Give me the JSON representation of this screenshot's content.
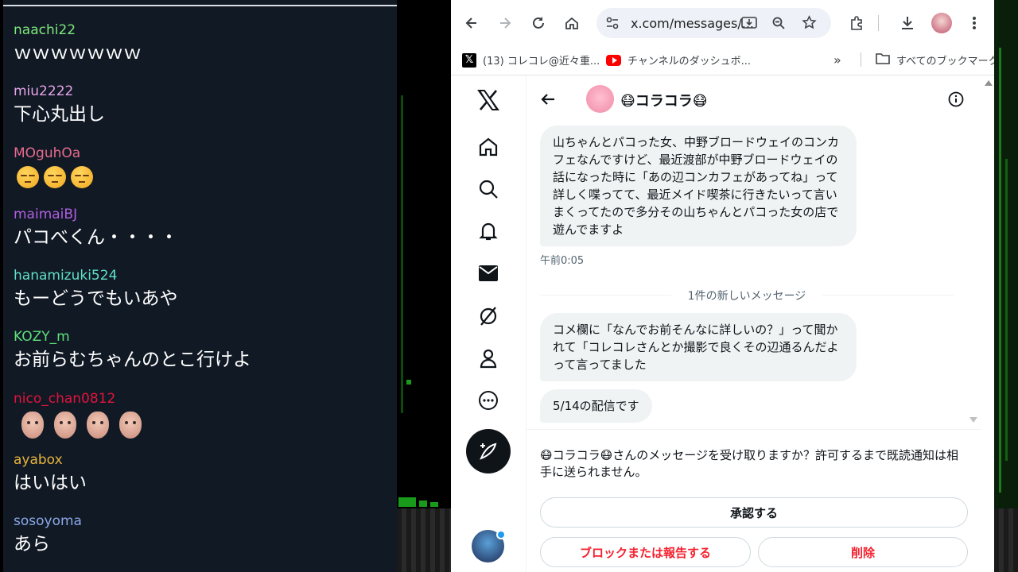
{
  "chat": {
    "messages": [
      {
        "user": "naachi22",
        "color": "#7de87a",
        "text": "ｗｗｗｗｗｗｗ"
      },
      {
        "user": "miu2222",
        "color": "#e5a4e8",
        "text": "下心丸出し"
      },
      {
        "user": "MOguhOa",
        "color": "#e86b8d",
        "emoji": "pensive-face-icon",
        "count": 3
      },
      {
        "user": "maimaiBJ",
        "color": "#b05fe0",
        "text": "パコべくん・・・・"
      },
      {
        "user": "hanamizuki524",
        "color": "#5fe0c8",
        "text": "もーどうでもいあや"
      },
      {
        "user": "KOZY_m",
        "color": "#5fe07a",
        "text": "お前らむちゃんのとこ行けよ"
      },
      {
        "user": "nico_chan0812",
        "color": "#e0143c",
        "emoji": "face-sticker-icon",
        "count": 4
      },
      {
        "user": "ayabox",
        "color": "#e8b43c",
        "text": "はいはい"
      },
      {
        "user": "sosoyoma",
        "color": "#8aa8e8",
        "text": "あら"
      }
    ]
  },
  "browser": {
    "url": "x.com/messages/...",
    "bookmarks": [
      {
        "label": "(13) コレコレ@近々重...",
        "icon": "x-logo-icon"
      },
      {
        "label": "チャンネルのダッシュボ...",
        "icon": "youtube-icon"
      }
    ],
    "all_bookmarks": "すべてのブックマーク"
  },
  "conversation": {
    "name": "😷コラコラ😷",
    "messages": [
      "山ちゃんとパコった女、中野ブロードウェイのコンカフェなんですけど、最近渡部が中野ブロードウェイの話になった時に「あの辺コンカフェがあってね」って詳しく喋ってて、最近メイド喫茶に行きたいって言いまくってたので多分その山ちゃんとパコった女の店で遊んでますよ",
      "コメ欄に「なんでお前そんなに詳しいの？」って聞かれて「コレコレさんとか撮影で良くその辺通るんだよって言ってました",
      "5/14の配信です"
    ],
    "timestamp": "午前0:05",
    "new_divider": "1件の新しいメッセージ",
    "request_text": "😷コラコラ😷さんのメッセージを受け取りますか？許可するまで既読通知は相手に送られません。",
    "accept": "承認する",
    "block": "ブロックまたは報告する",
    "delete": "削除"
  },
  "colors": {
    "chat_bg": "#111925",
    "accent_red": "#f4212e"
  }
}
